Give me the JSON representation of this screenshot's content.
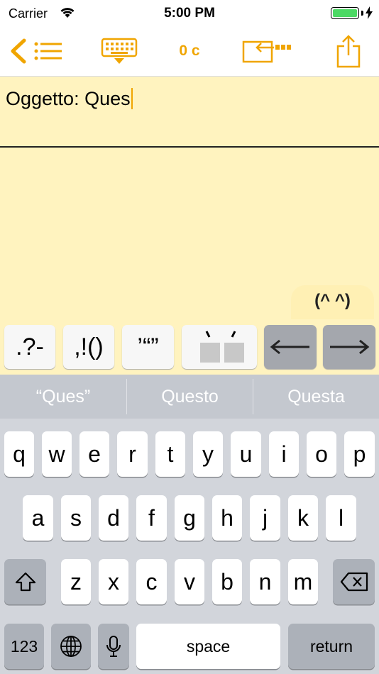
{
  "status_bar": {
    "carrier": "Carrier",
    "time": "5:00 PM"
  },
  "toolbar": {
    "char_count": "0 c"
  },
  "editor": {
    "text": "Oggetto: Ques"
  },
  "kaomoji": "(^ ^)",
  "accessory_keys": [
    ".?-",
    ",!()",
    "’“”",
    "◌̀ ◌́",
    "⟵",
    "⟶"
  ],
  "suggestions": [
    "“Ques”",
    "Questo",
    "Questa"
  ],
  "keyboard": {
    "row1": [
      "q",
      "w",
      "e",
      "r",
      "t",
      "y",
      "u",
      "i",
      "o",
      "p"
    ],
    "row2": [
      "a",
      "s",
      "d",
      "f",
      "g",
      "h",
      "j",
      "k",
      "l"
    ],
    "row3": [
      "z",
      "x",
      "c",
      "v",
      "b",
      "n",
      "m"
    ],
    "numbers_label": "123",
    "space_label": "space",
    "return_label": "return"
  },
  "colors": {
    "accent": "#f0a500",
    "editor_bg": "#fff3bf",
    "keyboard_bg": "#d2d5db"
  }
}
